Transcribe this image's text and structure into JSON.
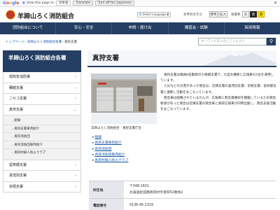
{
  "google_bar": {
    "brand": "Google",
    "view_label": "View this page in:",
    "language": "日本語",
    "translate_button": "Translate",
    "turn_off_button": "Turn off for: Japanese",
    "close_icon": "close-icon"
  },
  "header": {
    "site_title": "羊蹄山ろく消防組合",
    "translate_select": "Select Language ▼",
    "font_size_label": "文字の大きさ",
    "font_standard": "標準",
    "font_large": "拡大",
    "bg_color_label": "背景色",
    "bg_white": "白",
    "bg_black": "黒",
    "bg_yellow": "黄"
  },
  "nav": {
    "items": [
      "消防組合について",
      "安心・安全",
      "申請・届け出",
      "講習会・試験",
      "採用情報"
    ]
  },
  "breadcrumb": {
    "items": [
      "トップページ",
      "羊蹄山ろく消防組合各署",
      "真狩支署"
    ]
  },
  "site_search": {
    "placeholder": "キーワードを入力してください",
    "button_icon": "search-icon"
  },
  "sidebar": {
    "heading": "羊蹄山ろく消防組合各署",
    "items": [
      {
        "label": "俱知安消防署"
      },
      {
        "label": "蘭越支署"
      },
      {
        "label": "ニセコ支署"
      },
      {
        "label": "真狩支署"
      }
    ],
    "subitems": [
      "組織",
      "真狩支署車両紹介",
      "真狩消防団",
      "真狩消防団車両紹介",
      "真狩村婦人防火クラブ"
    ],
    "items_after": [
      {
        "label": "留寿都支署"
      },
      {
        "label": "喜茂別支署"
      },
      {
        "label": "京極支署"
      }
    ]
  },
  "main": {
    "title": "真狩支署",
    "photo_caption": "羊蹄山ろく消防組合　真狩支署庁舎",
    "intro_1": "真狩支署は職員8名勤務の小規模支署で、大型水槽車と広報車の2台を運用しています。",
    "intro_2": "火災などの災害があった場合は、近隣支署の喜茂別支署、京極支署、留寿都支署と連携し活動をおこなっています。",
    "intro_3": "救急車は配備されていませんが、広報車に救急資機材を積載しているため救急要請があった場合は近隣支署の救急車と真狩広報車が同時出動し、救急支援活動をおこなっています。",
    "links": [
      "組織",
      "真狩支署車両紹介",
      "真狩消防団",
      "真狩消防団車両紹介",
      "真狩村婦人防火クラブ"
    ],
    "info": [
      {
        "label": "所在地",
        "value_1": "〒048-1631",
        "value_2": "北海道虻田郡真狩村字真狩52番地2"
      },
      {
        "label": "電話番号",
        "value_1": "0136-45-2319",
        "value_2": ""
      }
    ]
  }
}
